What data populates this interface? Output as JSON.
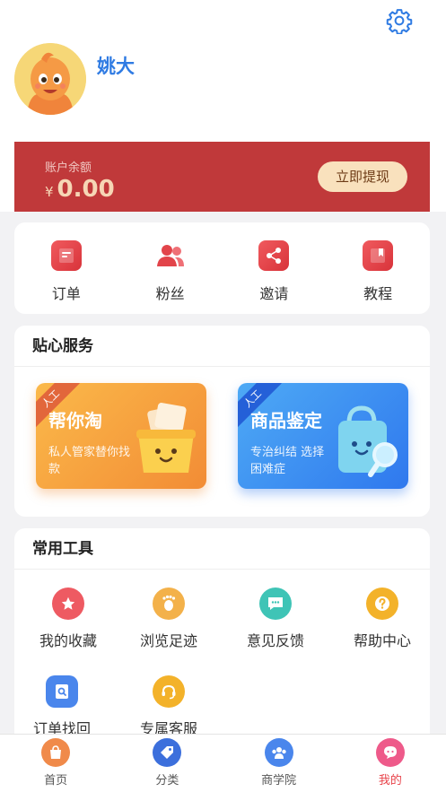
{
  "profile": {
    "name": "姚大"
  },
  "balance": {
    "label": "账户余额",
    "currency": "¥",
    "amount": "0.00",
    "withdraw_label": "立即提现"
  },
  "quick_actions": [
    {
      "label": "订单",
      "icon": "order-icon"
    },
    {
      "label": "粉丝",
      "icon": "fans-icon"
    },
    {
      "label": "邀请",
      "icon": "share-icon"
    },
    {
      "label": "教程",
      "icon": "book-icon"
    }
  ],
  "services": {
    "title": "贴心服务",
    "cards": [
      {
        "badge": "人工",
        "title": "帮你淘",
        "subtitle": "私人管家替你找款",
        "icon": "shopping-basket-icon"
      },
      {
        "badge": "人工",
        "title": "商品鉴定",
        "subtitle": "专治纠结 选择困难症",
        "icon": "bag-magnifier-icon"
      }
    ]
  },
  "tools": {
    "title": "常用工具",
    "items": [
      {
        "label": "我的收藏",
        "icon": "star-icon",
        "color": "#ee5a62"
      },
      {
        "label": "浏览足迹",
        "icon": "footprint-icon",
        "color": "#f3b14a"
      },
      {
        "label": "意见反馈",
        "icon": "chat-icon",
        "color": "#3fc4b6"
      },
      {
        "label": "帮助中心",
        "icon": "question-icon",
        "color": "#f3b22a"
      },
      {
        "label": "订单找回",
        "icon": "order-search-icon",
        "color": "#4a86ec"
      },
      {
        "label": "专属客服",
        "icon": "headset-icon",
        "color": "#f3b22a"
      }
    ]
  },
  "tabbar": [
    {
      "label": "首页",
      "icon": "home-bag-icon",
      "color": "#f08a4a",
      "active": false
    },
    {
      "label": "分类",
      "icon": "tag-icon",
      "color": "#3c6fdc",
      "active": false
    },
    {
      "label": "商学院",
      "icon": "people-icon",
      "color": "#4a86ec",
      "active": false
    },
    {
      "label": "我的",
      "icon": "profile-chat-icon",
      "color": "#ee5a8a",
      "active": true
    }
  ],
  "colors": {
    "accent_blue": "#2f7be3",
    "balance_bg": "#c0393a",
    "active_tab": "#e8434a"
  }
}
